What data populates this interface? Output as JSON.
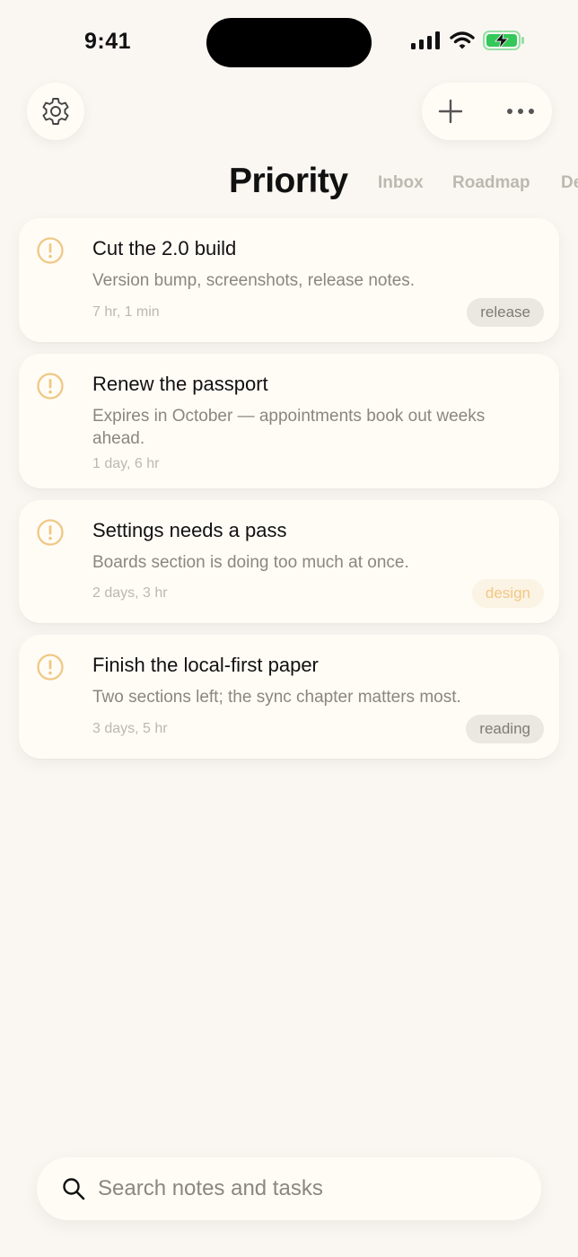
{
  "status_bar": {
    "time": "9:41",
    "icons": [
      "signal-icon",
      "wifi-icon",
      "battery-charging-icon"
    ],
    "battery_color": "#34c759"
  },
  "header": {
    "left_icon": "gear-icon",
    "action_icons": [
      "plus-icon",
      "more-icon"
    ]
  },
  "tabs": {
    "active": "Priority",
    "others": [
      "Inbox",
      "Roadmap",
      "De"
    ]
  },
  "tasks": [
    {
      "icon": "exclamation-circle-icon",
      "title": "Cut the 2.0 build",
      "description": "Version bump, screenshots, release notes.",
      "meta": "7 hr, 1 min",
      "tag": "release"
    },
    {
      "icon": "exclamation-circle-icon",
      "title": "Renew the passport",
      "description": "Expires in October — appointments book out weeks ahead.",
      "meta": "1 day, 6 hr",
      "tag": ""
    },
    {
      "icon": "exclamation-circle-icon",
      "title": "Settings needs a pass",
      "description": "Boards section is doing too much at once.",
      "meta": "2 days, 3 hr",
      "tag": "design"
    },
    {
      "icon": "exclamation-circle-icon",
      "title": "Finish the local-first paper",
      "description": "Two sections left; the sync chapter matters most.",
      "meta": "3 days, 5 hr",
      "tag": "reading"
    }
  ],
  "search": {
    "placeholder": "Search notes and tasks",
    "icon": "search-icon"
  },
  "colors": {
    "background": "#faf7f2",
    "card": "#fffcf6",
    "priority_accent": "#f0c885",
    "design_tag": "#f2c784",
    "muted_text": "#8a8680"
  }
}
